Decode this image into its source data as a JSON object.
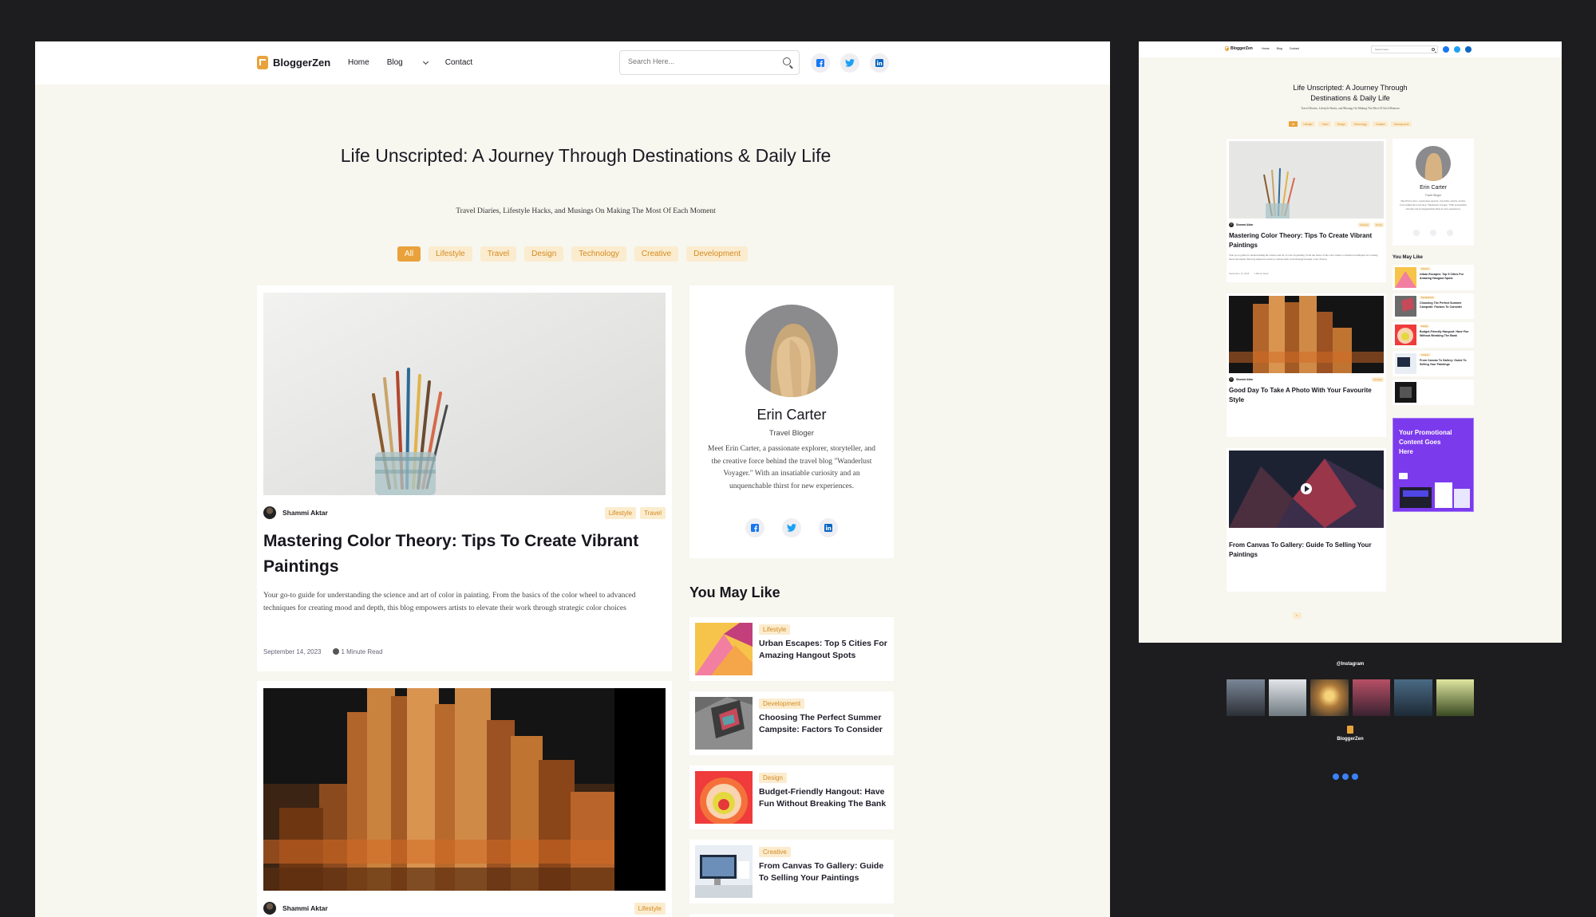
{
  "brand": {
    "name": "BloggerZen",
    "accent": "#e9a23b",
    "tag_bg": "#fbeccf",
    "page_bg": "#f7f6ef"
  },
  "nav": {
    "items": [
      "Home",
      "Blog",
      "Contact"
    ],
    "search_placeholder": "Search Here...",
    "social_icons": [
      "facebook-icon",
      "twitter-icon",
      "linkedin-icon"
    ]
  },
  "hero": {
    "title": "Life Unscripted: A Journey Through Destinations & Daily Life",
    "subtitle": "Travel Diaries, Lifestyle Hacks, and Musings On Making The Most Of Each Moment"
  },
  "categories": [
    "All",
    "Lifestyle",
    "Travel",
    "Design",
    "Technology",
    "Creative",
    "Development"
  ],
  "active_category": "All",
  "posts": [
    {
      "author": "Shammi Aktar",
      "tags": [
        "Lifestyle",
        "Travel"
      ],
      "title": "Mastering Color Theory: Tips To Create Vibrant Paintings",
      "excerpt": "Your go-to guide for understanding the science and art of color in painting. From the basics of the color wheel to advanced techniques for creating mood and depth, this blog empowers artists to elevate their work through strategic color choices",
      "date": "September 14, 2023",
      "read_time": "1 Minute Read"
    },
    {
      "author": "Shammi Aktar",
      "tags": [
        "Lifestyle"
      ],
      "title": "Good Day To Take A Photo With Your Favourite Style"
    },
    {
      "title": "From Canvas To Gallery: Guide To Selling Your Paintings"
    }
  ],
  "profile": {
    "name": "Erin Carter",
    "role": "Travel Bloger",
    "bio": "Meet Erin Carter, a passionate explorer, storyteller, and the creative force behind the travel blog \"Wanderlust Voyager.\" With an insatiable curiosity and an unquenchable thirst for new experiences."
  },
  "you_may_like": {
    "heading": "You May Like",
    "items": [
      {
        "tag": "Lifestyle",
        "title": "Urban Escapes: Top 5 Cities For Amazing Hangout Spots"
      },
      {
        "tag": "Development",
        "title": "Choosing The Perfect Summer Campsite: Factors To Consider"
      },
      {
        "tag": "Design",
        "title": "Budget-Friendly Hangout: Have Fun Without Breaking The Bank"
      },
      {
        "tag": "Creative",
        "title": "From Canvas To Gallery: Guide To Selling Your Paintings"
      }
    ]
  },
  "promo": {
    "text": "Your Promotional Content Goes Here"
  },
  "footer": {
    "instagram": "@Instagram",
    "brand": "BloggerZen"
  }
}
